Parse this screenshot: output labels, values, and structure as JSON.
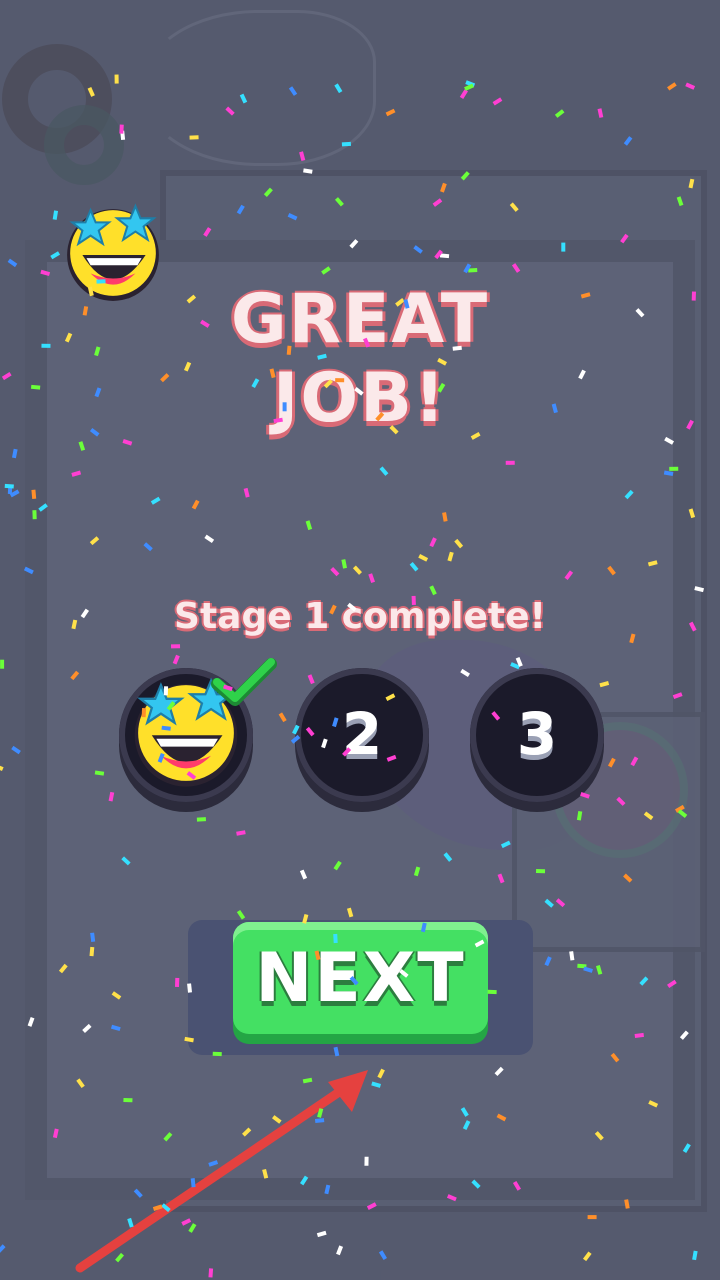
{
  "header": {
    "title": "GREAT JOB!"
  },
  "stage_progress": {
    "subtitle": "Stage 1 complete!",
    "stages": [
      {
        "label": "",
        "status": "complete",
        "icon": "star-eyes-emoji-icon"
      },
      {
        "label": "2",
        "status": "locked"
      },
      {
        "label": "3",
        "status": "locked"
      }
    ]
  },
  "next_button": {
    "label": "NEXT"
  },
  "colors": {
    "title_outline": "#d96a76",
    "button_green": "#44e063",
    "check_green": "#2fd24a",
    "arrow_red": "#e5413f",
    "emoji_yellow": "#ffe02a",
    "star_cyan": "#33c6f0"
  }
}
